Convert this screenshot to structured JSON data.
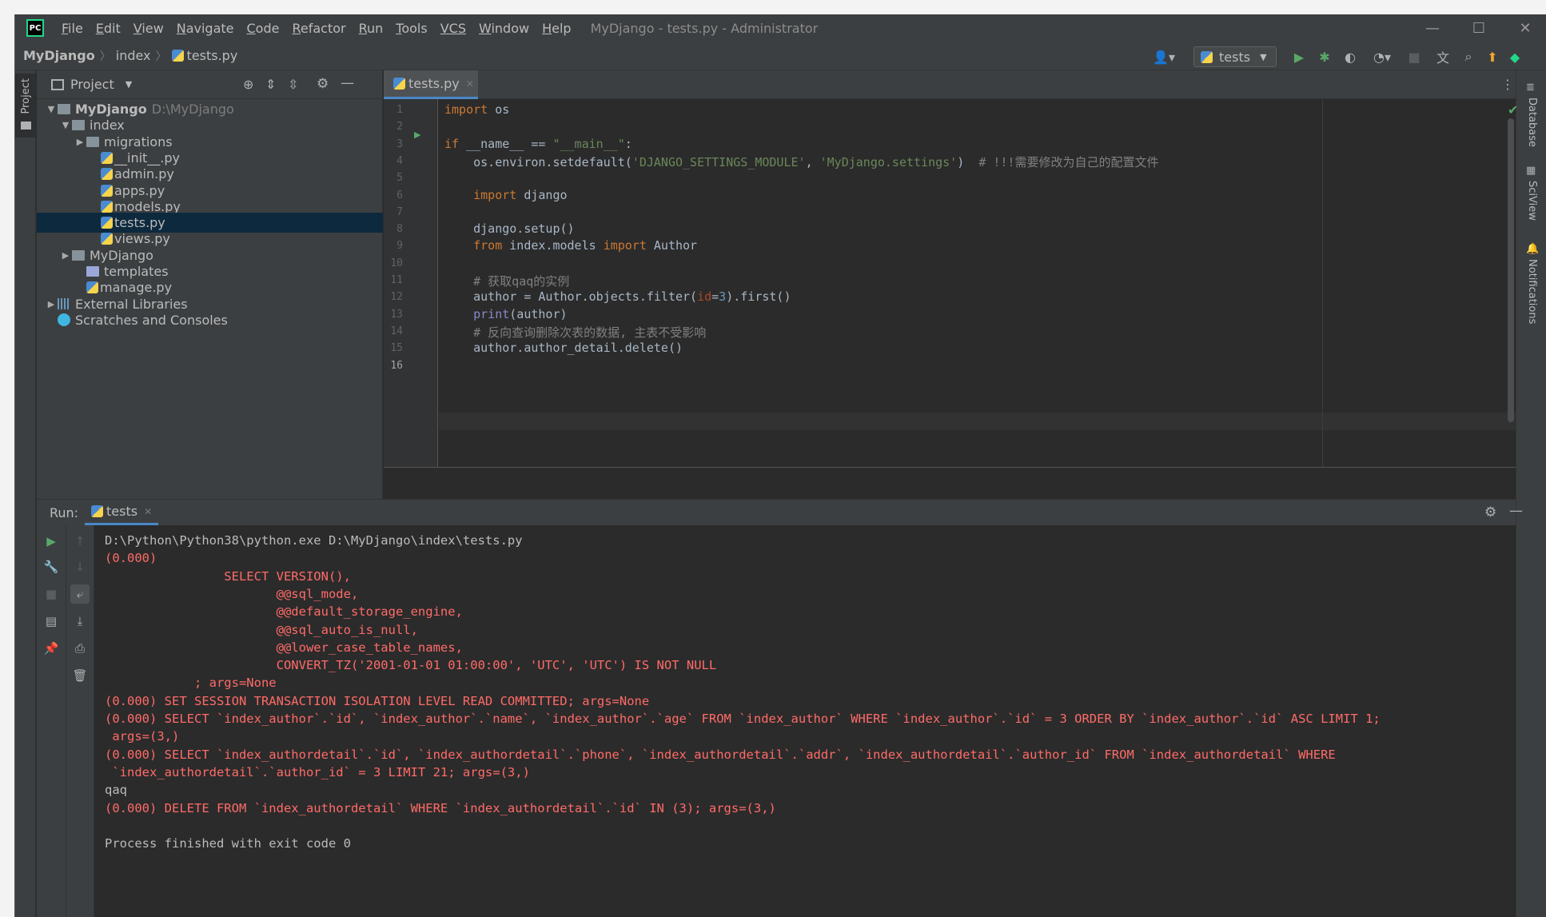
{
  "menu": {
    "items": [
      {
        "u": "F",
        "rest": "ile"
      },
      {
        "u": "E",
        "rest": "dit"
      },
      {
        "u": "V",
        "rest": "iew"
      },
      {
        "u": "N",
        "rest": "avigate"
      },
      {
        "u": "C",
        "rest": "ode"
      },
      {
        "u": "R",
        "rest": "efactor"
      },
      {
        "u": "R",
        "rest": "un"
      },
      {
        "u": "T",
        "rest": "ools"
      },
      {
        "u": "VCS",
        "rest": ""
      },
      {
        "u": "W",
        "rest": "indow"
      },
      {
        "u": "H",
        "rest": "elp"
      }
    ],
    "window_title": "MyDjango - tests.py - Administrator"
  },
  "navbar": {
    "crumbs": [
      "MyDjango",
      "index",
      "tests.py"
    ],
    "run_config": "tests"
  },
  "side": {
    "left_tab": "Project",
    "right_tabs": [
      "Database",
      "SciView",
      "Notifications"
    ]
  },
  "project": {
    "title": "Project",
    "tree": [
      {
        "label": "MyDjango",
        "path": "D:\\MyDjango",
        "indent": 0,
        "arrow": "open",
        "kind": "folder",
        "bold": true
      },
      {
        "label": "index",
        "indent": 1,
        "arrow": "open",
        "kind": "folder"
      },
      {
        "label": "migrations",
        "indent": 2,
        "arrow": "closed",
        "kind": "folder"
      },
      {
        "label": "__init__.py",
        "indent": 3,
        "kind": "py"
      },
      {
        "label": "admin.py",
        "indent": 3,
        "kind": "py"
      },
      {
        "label": "apps.py",
        "indent": 3,
        "kind": "py"
      },
      {
        "label": "models.py",
        "indent": 3,
        "kind": "py"
      },
      {
        "label": "tests.py",
        "indent": 3,
        "kind": "py",
        "selected": true
      },
      {
        "label": "views.py",
        "indent": 3,
        "kind": "py"
      },
      {
        "label": "MyDjango",
        "indent": 1,
        "arrow": "closed",
        "kind": "folder"
      },
      {
        "label": "templates",
        "indent": 2,
        "kind": "folder-purple"
      },
      {
        "label": "manage.py",
        "indent": 2,
        "kind": "py"
      },
      {
        "label": "External Libraries",
        "indent": 0,
        "arrow": "closed",
        "kind": "lib"
      },
      {
        "label": "Scratches and Consoles",
        "indent": 0,
        "kind": "scratch"
      }
    ]
  },
  "editor": {
    "tab": "tests.py",
    "lines": [
      [
        {
          "t": "import",
          "c": "kw"
        },
        {
          "t": " os",
          "c": ""
        }
      ],
      [],
      [
        {
          "t": "if",
          "c": "kw"
        },
        {
          "t": " __name__ == ",
          "c": ""
        },
        {
          "t": "\"__main__\"",
          "c": "str"
        },
        {
          "t": ":",
          "c": ""
        }
      ],
      [
        {
          "t": "    os.environ.setdefault(",
          "c": ""
        },
        {
          "t": "'DJANGO_SETTINGS_MODULE'",
          "c": "str"
        },
        {
          "t": ", ",
          "c": ""
        },
        {
          "t": "'MyDjango.settings'",
          "c": "str"
        },
        {
          "t": ")  ",
          "c": ""
        },
        {
          "t": "# !!!需要修改为自己的配置文件",
          "c": "cmt"
        }
      ],
      [],
      [
        {
          "t": "    ",
          "c": ""
        },
        {
          "t": "import",
          "c": "kw"
        },
        {
          "t": " django",
          "c": ""
        }
      ],
      [],
      [
        {
          "t": "    django.setup()",
          "c": ""
        }
      ],
      [
        {
          "t": "    ",
          "c": ""
        },
        {
          "t": "from",
          "c": "kw"
        },
        {
          "t": " index.models ",
          "c": ""
        },
        {
          "t": "import",
          "c": "kw"
        },
        {
          "t": " Author",
          "c": ""
        }
      ],
      [],
      [
        {
          "t": "    # 获取qaq的实例",
          "c": "cmt"
        }
      ],
      [
        {
          "t": "    author = Author.objects.filter(",
          "c": ""
        },
        {
          "t": "id",
          "c": "par"
        },
        {
          "t": "=",
          "c": ""
        },
        {
          "t": "3",
          "c": "num"
        },
        {
          "t": ").first()",
          "c": ""
        }
      ],
      [
        {
          "t": "    ",
          "c": ""
        },
        {
          "t": "print",
          "c": "bi"
        },
        {
          "t": "(author)",
          "c": ""
        }
      ],
      [
        {
          "t": "    # 反向查询删除次表的数据, 主表不受影响",
          "c": "cmt"
        }
      ],
      [
        {
          "t": "    author.author_detail.delete()",
          "c": ""
        }
      ],
      []
    ]
  },
  "run": {
    "label": "Run:",
    "tab": "tests",
    "console": [
      {
        "t": "D:\\Python\\Python38\\python.exe D:\\MyDjango\\index\\tests.py",
        "c": "norm"
      },
      {
        "t": "(0.000)",
        "c": "red"
      },
      {
        "t": "                SELECT VERSION(),",
        "c": "red"
      },
      {
        "t": "                       @@sql_mode,",
        "c": "red"
      },
      {
        "t": "                       @@default_storage_engine,",
        "c": "red"
      },
      {
        "t": "                       @@sql_auto_is_null,",
        "c": "red"
      },
      {
        "t": "                       @@lower_case_table_names,",
        "c": "red"
      },
      {
        "t": "                       CONVERT_TZ('2001-01-01 01:00:00', 'UTC', 'UTC') IS NOT NULL",
        "c": "red"
      },
      {
        "t": "            ; args=None",
        "c": "red"
      },
      {
        "t": "(0.000) SET SESSION TRANSACTION ISOLATION LEVEL READ COMMITTED; args=None",
        "c": "red"
      },
      {
        "t": "(0.000) SELECT `index_author`.`id`, `index_author`.`name`, `index_author`.`age` FROM `index_author` WHERE `index_author`.`id` = 3 ORDER BY `index_author`.`id` ASC LIMIT 1;",
        "c": "red"
      },
      {
        "t": " args=(3,)",
        "c": "red"
      },
      {
        "t": "(0.000) SELECT `index_authordetail`.`id`, `index_authordetail`.`phone`, `index_authordetail`.`addr`, `index_authordetail`.`author_id` FROM `index_authordetail` WHERE",
        "c": "red"
      },
      {
        "t": " `index_authordetail`.`author_id` = 3 LIMIT 21; args=(3,)",
        "c": "red"
      },
      {
        "t": "qaq",
        "c": "norm"
      },
      {
        "t": "(0.000) DELETE FROM `index_authordetail` WHERE `index_authordetail`.`id` IN (3); args=(3,)",
        "c": "red"
      },
      {
        "t": "",
        "c": "norm"
      },
      {
        "t": "Process finished with exit code 0",
        "c": "norm"
      }
    ]
  }
}
